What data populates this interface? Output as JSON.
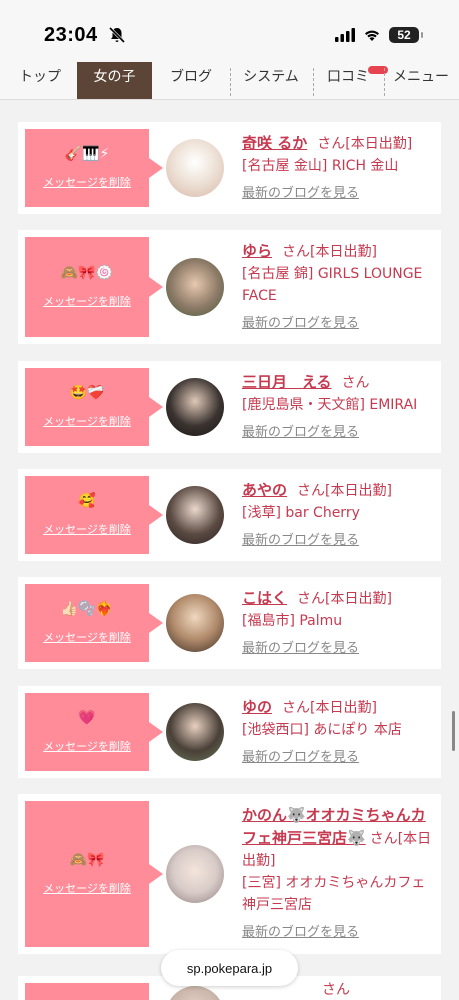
{
  "status_bar": {
    "time": "23:04",
    "battery": "52"
  },
  "nav": {
    "items": [
      {
        "label": "トップ"
      },
      {
        "label": "女の子"
      },
      {
        "label": "ブログ"
      },
      {
        "label": "システム"
      },
      {
        "label": "口コミ"
      },
      {
        "label": "メニュー"
      }
    ]
  },
  "cards": [
    {
      "emoji": "🎸🎹⚡",
      "delete_label": "メッセージを削除",
      "name": "奇咲 るか",
      "san": "さん",
      "status": "[本日出勤]",
      "shop": "[名古屋 金山] RICH 金山",
      "blog_label": "最新のブログを見る",
      "avatar_color": "#e8dcd4"
    },
    {
      "emoji": "🙈🎀🍥",
      "delete_label": "メッセージを削除",
      "name": "ゆら",
      "san": "さん",
      "status": "[本日出勤]",
      "shop": "[名古屋 錦] GIRLS LOUNGE FACE",
      "blog_label": "最新のブログを見る",
      "avatar_color": "#8c7a66"
    },
    {
      "emoji": "🤩❤️‍🩹",
      "delete_label": "メッセージを削除",
      "name": "三日月　える",
      "san": "さん",
      "status": "",
      "shop": "[鹿児島県・天文館] EMIRAI",
      "blog_label": "最新のブログを見る",
      "avatar_color": "#3a3330"
    },
    {
      "emoji": "🥰",
      "delete_label": "メッセージを削除",
      "name": "あやの",
      "san": "さん",
      "status": "[本日出勤]",
      "shop": "[浅草] bar Cherry",
      "blog_label": "最新のブログを見る",
      "avatar_color": "#5a4a42"
    },
    {
      "emoji": "👍🏻🫧❤️‍🔥",
      "delete_label": "メッセージを削除",
      "name": "こはく",
      "san": "さん",
      "status": "[本日出勤]",
      "shop": "[福島市] Palmu",
      "blog_label": "最新のブログを見る",
      "avatar_color": "#b08a6a"
    },
    {
      "emoji": "💗",
      "delete_label": "メッセージを削除",
      "name": "ゆの",
      "san": "さん",
      "status": "[本日出勤]",
      "shop": "[池袋西口] あにぽり 本店",
      "blog_label": "最新のブログを見る",
      "avatar_color": "#4a4038"
    },
    {
      "emoji": "🙈🎀",
      "delete_label": "メッセージを削除",
      "name": "かのん🐺オオカミちゃんカフェ神戸三宮店🐺",
      "san": "さん",
      "status": "[本日出勤]",
      "shop": "[三宮] オオカミちゃんカフェ神戸三宮店",
      "blog_label": "最新のブログを見る",
      "avatar_color": "#d8ccc8"
    },
    {
      "emoji": "",
      "delete_label": "",
      "name": "",
      "san": "さん",
      "status": "",
      "shop": "",
      "blog_label": "",
      "avatar_color": "#c8b4a8"
    }
  ],
  "footer": {
    "url": "sp.pokepara.jp"
  },
  "colors": {
    "accent": "#c63a50",
    "pink_box": "#ff8c98",
    "nav_active": "#5c4537"
  }
}
